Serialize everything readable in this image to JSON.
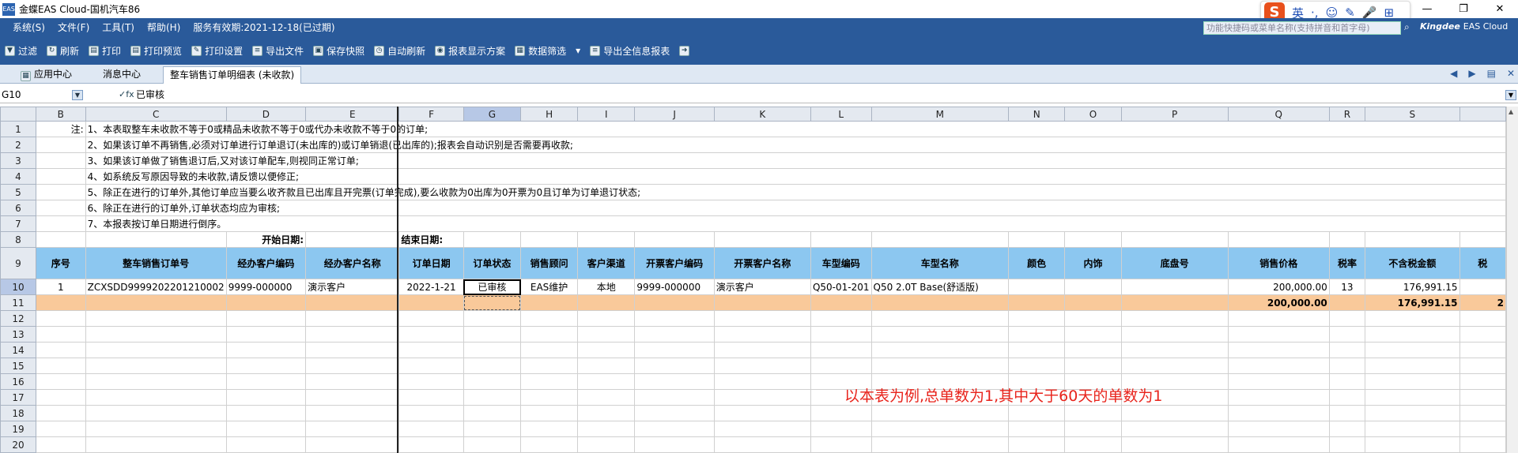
{
  "window": {
    "title": "金蝶EAS Cloud-国机汽车86",
    "app_logo": "EAS",
    "controls": [
      "—",
      "❐",
      "✕"
    ]
  },
  "ime_bar": {
    "logo": "S",
    "items": [
      "英",
      "·,",
      "☺",
      "✎",
      "🎤",
      "⊞"
    ]
  },
  "menu": {
    "items": [
      "系统(S)",
      "文件(F)",
      "工具(T)",
      "帮助(H)",
      "服务有效期:2021-12-18(已过期)"
    ],
    "search_placeholder": "功能快捷码或菜单名称(支持拼音和首字母)",
    "brand": "Kingdee",
    "brand_sub": "EAS Cloud"
  },
  "toolbar": {
    "buttons": [
      "过滤",
      "刷新",
      "打印",
      "打印预览",
      "打印设置",
      "导出文件",
      "保存快照",
      "自动刷新",
      "报表显示方案",
      "数据筛选",
      "▾",
      "导出全信息报表",
      ""
    ]
  },
  "tabs": [
    "应用中心",
    "消息中心",
    "整车销售订单明细表 (未收款)"
  ],
  "formula_bar": {
    "cell_ref": "G10",
    "value": "已审核"
  },
  "sheet": {
    "columns": [
      "B",
      "C",
      "D",
      "E",
      "F",
      "G",
      "H",
      "I",
      "J",
      "K",
      "L",
      "M",
      "N",
      "O",
      "P",
      "Q",
      "R",
      "S",
      ""
    ],
    "notes": [
      {
        "label": "注:",
        "text": "1、本表取整车未收款不等于0或精品未收款不等于0或代办未收款不等于0的订单;"
      },
      {
        "label": "",
        "text": "2、如果该订单不再销售,必须对订单进行订单退订(未出库的)或订单销退(已出库的);报表会自动识别是否需要再收款;"
      },
      {
        "label": "",
        "text": "3、如果该订单做了销售退订后,又对该订单配车,则视同正常订单;"
      },
      {
        "label": "",
        "text": "4、如系统反写原因导致的未收款,请反馈以便修正;"
      },
      {
        "label": "",
        "text": "5、除正在进行的订单外,其他订单应当要么收齐款且已出库且开完票(订单完成),要么收款为0出库为0开票为0且订单为订单退订状态;"
      },
      {
        "label": "",
        "text": "6、除正在进行的订单外,订单状态均应为审核;"
      },
      {
        "label": "",
        "text": "7、本报表按订单日期进行倒序。"
      }
    ],
    "start_date_label": "开始日期:",
    "end_date_label": "结束日期:",
    "headers": [
      "序号",
      "整车销售订单号",
      "经办客户编码",
      "经办客户名称",
      "订单日期",
      "订单状态",
      "销售顾问",
      "客户渠道",
      "开票客户编码",
      "开票客户名称",
      "车型编码",
      "车型名称",
      "颜色",
      "内饰",
      "底盘号",
      "销售价格",
      "税率",
      "不含税金额",
      "税"
    ],
    "data_row": [
      "1",
      "ZCXSDD9999202201210002",
      "9999-000000",
      "演示客户",
      "2022-1-21",
      "已审核",
      "EAS维护",
      "本地",
      "9999-000000",
      "演示客户",
      "Q50-01-201",
      "Q50 2.0T Base(舒适版)",
      "",
      "",
      "",
      "200,000.00",
      "13",
      "176,991.15",
      ""
    ],
    "total_row": {
      "price": "200,000.00",
      "amount": "176,991.15",
      "tax_partial": "2"
    },
    "empty_rows": [
      "12",
      "13",
      "14",
      "15",
      "16",
      "17",
      "18",
      "19",
      "20"
    ]
  },
  "annotation": "以本表为例,总单数为1,其中大于60天的单数为1"
}
